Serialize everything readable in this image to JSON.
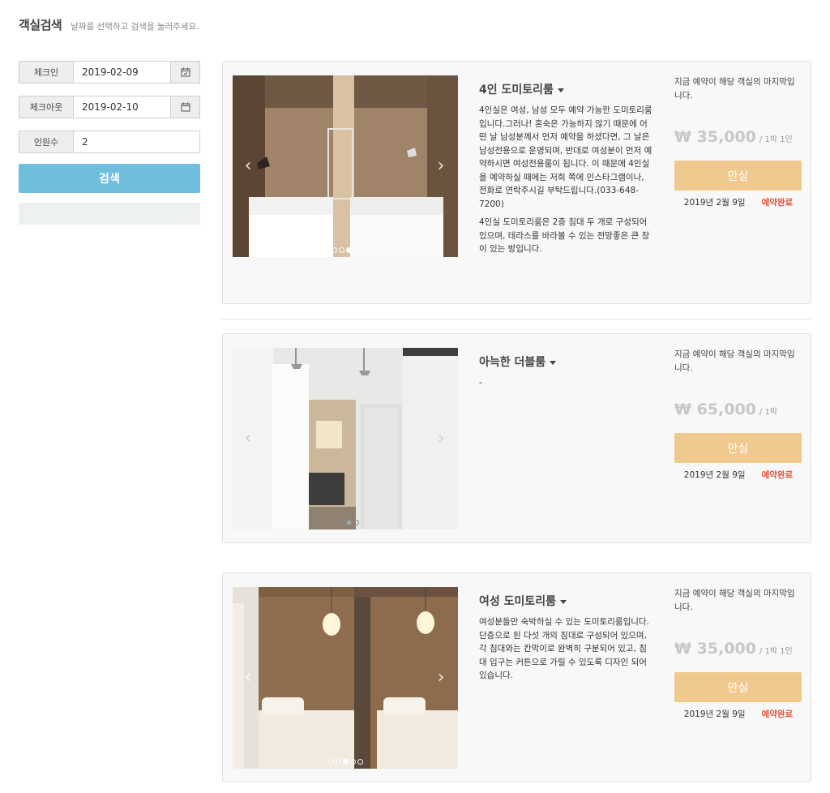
{
  "header": {
    "title": "객실검색",
    "subtitle": "날짜를 선택하고 검색을 눌러주세요."
  },
  "search": {
    "checkin_label": "체크인",
    "checkin_value": "2019-02-09",
    "checkout_label": "체크아웃",
    "checkout_value": "2019-02-10",
    "guests_label": "인원수",
    "guests_value": "2",
    "search_button": "검색",
    "calendar_icon": "calendar-icon"
  },
  "rooms": [
    {
      "name": "4인 도미토리룸",
      "desc": [
        "4인실은 여성, 남성 모두 예약 가능한 도미토리룸입니다.그러나! 혼숙은 가능하지 않기 때문에 어떤 날 남성분께서 먼저 예약을 하셨다면, 그 날은 남성전용으로 운영되며, 반대로 여성분이 먼저 예약하시면 여성전용룸이 됩니다. 이 때문에 4인실을 예약하실 때에는 저희 쪽에 인스타그램이나, 전화로 연락주시길 부탁드립니다.(033-648-7200)",
        "4인실 도미토리룸은 2층 침대 두 개로 구성되어있으며, 테라스를 바라볼 수 있는 전망좋은 큰 창이 있는 방입니다."
      ],
      "last_room": "지금 예약이 해당 객실의 마지막입니다.",
      "price": "₩ 35,000",
      "per": "/ 1박 1인",
      "button": "만실",
      "date": "2019년 2월 9일",
      "status": "예약완료",
      "photo_dots": 4,
      "active_dot": 2
    },
    {
      "name": "아늑한 더블룸",
      "desc": [
        "-"
      ],
      "last_room": "지금 예약이 해당 객실의 마지막입니다.",
      "price": "₩ 65,000",
      "per": "/ 1박",
      "button": "만실",
      "date": "2019년 2월 9일",
      "status": "예약완료",
      "photo_dots": 4,
      "active_dot": 2
    },
    {
      "name": "여성 도미토리룸",
      "desc": [
        "여성분들만 숙박하실 수 있는 도미토리룸입니다. 단층으로 된 다섯 개의 침대로 구성되어 있으며, 각 침대와는 칸막이로 완벽히 구분되어 있고, 침대 입구는 커튼으로 가릴 수 있도록 디자인 되어 있습니다."
      ],
      "last_room": "지금 예약이 해당 객실의 마지막입니다.",
      "price": "₩ 35,000",
      "per": "/ 1박 1인",
      "button": "만실",
      "date": "2019년 2월 9일",
      "status": "예약완료",
      "photo_dots": 5,
      "active_dot": 2
    }
  ],
  "colors": {
    "search_button": "#6fbfdc",
    "soldout_button": "#f0c98e",
    "status_text": "#e0523d",
    "price_text": "#c8c8c8"
  }
}
